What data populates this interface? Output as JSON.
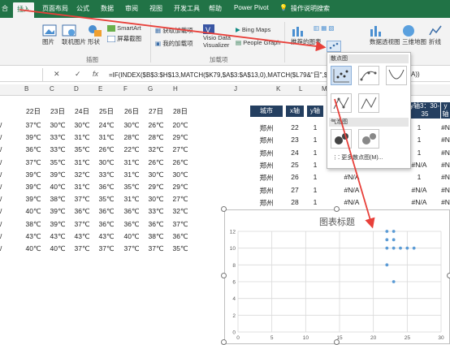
{
  "ribbon": {
    "tabs": [
      "合",
      "插入",
      "页面布局",
      "公式",
      "数据",
      "审阅",
      "视图",
      "开发工具",
      "帮助",
      "Power Pivot"
    ],
    "search_label": "操作说明搜索",
    "buttons": {
      "pictures": "图片",
      "online_pictures": "联机图片",
      "shapes": "形状",
      "smartart": "SmartArt",
      "screenshot": "屏幕截图",
      "get_addins": "获取加载项",
      "my_addins": "我的加载项",
      "visio": "Visio Data Visualizer",
      "bing_maps": "Bing Maps",
      "people_graph": "People Graph",
      "recommended_charts": "推荐的图表",
      "pivotchart": "数据透视图",
      "map3d": "三维地图",
      "line": "折线"
    },
    "groups": {
      "illustrations": "插图",
      "addins": "加载项"
    }
  },
  "formula_bar": {
    "cancel": "✕",
    "enter": "✓",
    "fx": "fx",
    "formula": "=IF(INDEX($B$3:$H$13,MATCH($K79,$A$3:$A$13,0),MATCH($L79&\"日\",$",
    "formula_tail": "A))"
  },
  "columns": [
    "B",
    "C",
    "D",
    "E",
    "F",
    "G",
    "H",
    "J",
    "K",
    "L",
    "M"
  ],
  "left_table": {
    "headers": [
      "22日",
      "23日",
      "24日",
      "25日",
      "26日",
      "27日",
      "28日"
    ],
    "rows": [
      [
        "37℃",
        "30℃",
        "30℃",
        "24℃",
        "30℃",
        "26℃",
        "20℃"
      ],
      [
        "39℃",
        "33℃",
        "31℃",
        "31℃",
        "28℃",
        "28℃",
        "29℃"
      ],
      [
        "36℃",
        "33℃",
        "35℃",
        "26℃",
        "22℃",
        "32℃",
        "27℃"
      ],
      [
        "37℃",
        "35℃",
        "31℃",
        "30℃",
        "31℃",
        "26℃",
        "26℃"
      ],
      [
        "39℃",
        "39℃",
        "32℃",
        "33℃",
        "31℃",
        "30℃",
        "30℃"
      ],
      [
        "39℃",
        "40℃",
        "31℃",
        "36℃",
        "35℃",
        "29℃",
        "29℃"
      ],
      [
        "39℃",
        "38℃",
        "37℃",
        "35℃",
        "31℃",
        "30℃",
        "27℃"
      ],
      [
        "40℃",
        "39℃",
        "36℃",
        "36℃",
        "36℃",
        "33℃",
        "32℃"
      ],
      [
        "38℃",
        "39℃",
        "37℃",
        "36℃",
        "36℃",
        "36℃",
        "37℃"
      ],
      [
        "43℃",
        "43℃",
        "43℃",
        "43℃",
        "40℃",
        "38℃",
        "36℃"
      ],
      [
        "40℃",
        "40℃",
        "37℃",
        "37℃",
        "37℃",
        "37℃",
        "35℃"
      ]
    ]
  },
  "right_table": {
    "headers": [
      "城市",
      "x轴",
      "y轴"
    ],
    "extra_headers": [
      "y轴3：30-35",
      "y轴4"
    ],
    "rows": [
      {
        "city": "郑州",
        "x": "22",
        "y": "1",
        "c1": "",
        "c2": "1",
        "c3": "#N"
      },
      {
        "city": "郑州",
        "x": "23",
        "y": "1",
        "c1": "",
        "c2": "1",
        "c3": "#N"
      },
      {
        "city": "郑州",
        "x": "24",
        "y": "1",
        "c1": "",
        "c2": "1",
        "c3": "#N"
      },
      {
        "city": "郑州",
        "x": "25",
        "y": "1",
        "c1": "",
        "c2": "#N/A",
        "c3": "#N"
      },
      {
        "city": "郑州",
        "x": "26",
        "y": "1",
        "c1": "#N/A",
        "c2": "1",
        "c3": "#N"
      },
      {
        "city": "郑州",
        "x": "27",
        "y": "1",
        "c1": "#N/A",
        "c2": "#N/A",
        "c3": "#N"
      },
      {
        "city": "郑州",
        "x": "28",
        "y": "1",
        "c1": "#N/A",
        "c2": "#N/A",
        "c3": "#N"
      }
    ]
  },
  "dropdown": {
    "section_scatter": "散点图",
    "section_bubble": "气泡图",
    "more": "更多散点图(M)..."
  },
  "chart_data": {
    "type": "scatter",
    "title": "图表标题",
    "xlim": [
      0,
      30
    ],
    "ylim": [
      0,
      12
    ],
    "xticks": [
      "0",
      "5",
      "10",
      "15",
      "20",
      "25",
      "30"
    ],
    "yticks": [
      "0",
      "2",
      "4",
      "6",
      "8",
      "10",
      "12"
    ],
    "grid": true,
    "series": [
      {
        "x": [
          22,
          22,
          22,
          22,
          23,
          23,
          23,
          23,
          24,
          25,
          26
        ],
        "y": [
          8,
          10,
          11,
          12,
          6,
          10,
          11,
          12,
          10,
          10,
          10
        ]
      }
    ],
    "colors": {
      "marker": "#5b9bd5",
      "arrow": "#e8403a"
    }
  }
}
